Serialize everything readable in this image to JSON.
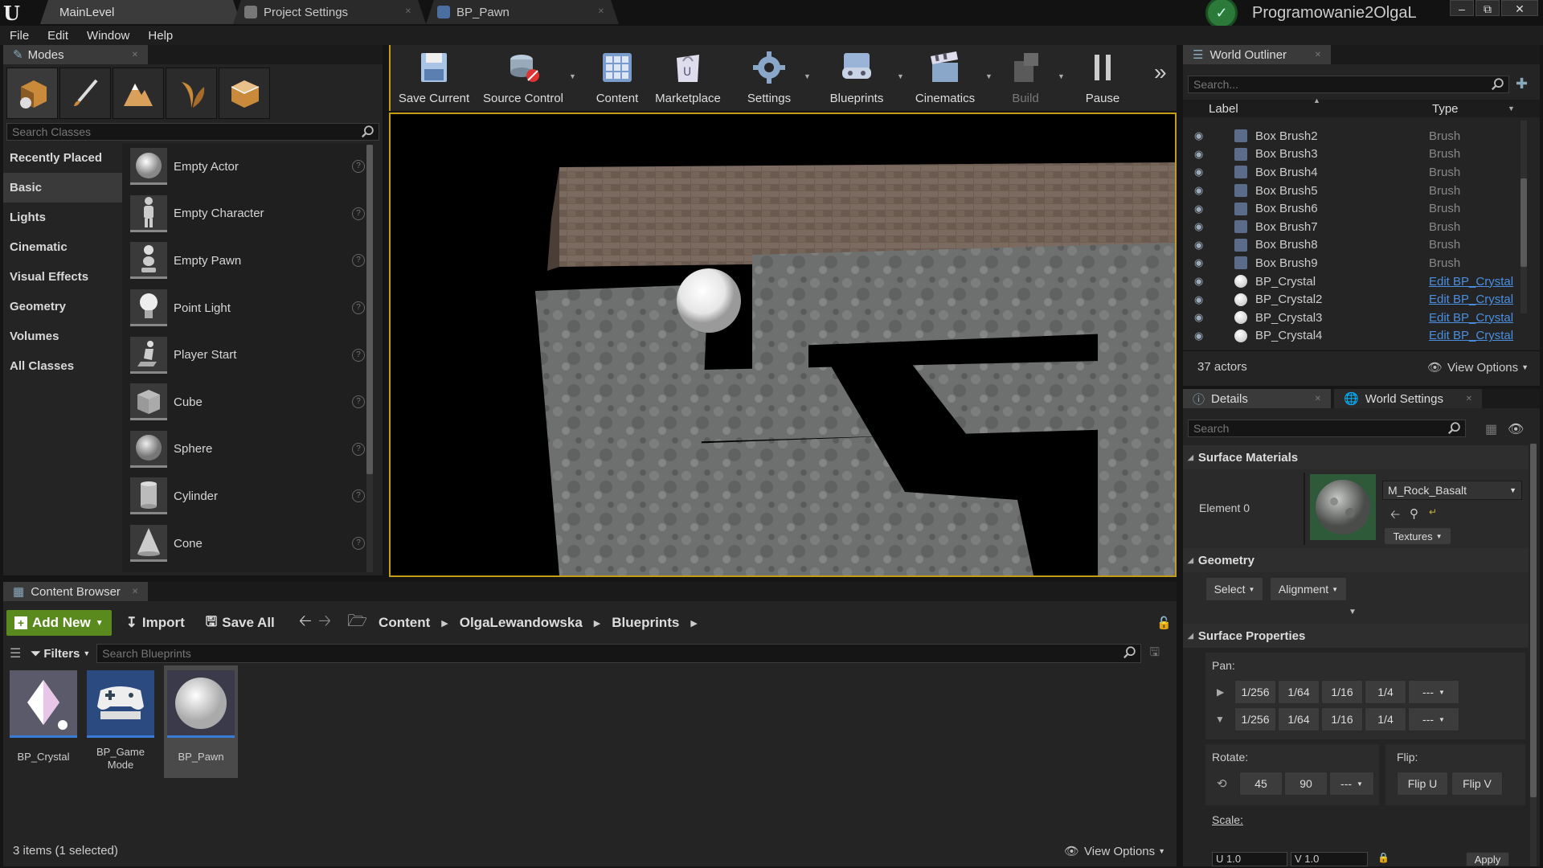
{
  "window": {
    "tabs": [
      {
        "label": "MainLevel"
      },
      {
        "label": "Project Settings"
      },
      {
        "label": "BP_Pawn"
      }
    ],
    "user": "Programowanie2OlgaL",
    "controls": {
      "minimize": "–",
      "restore": "⧉",
      "close": "✕"
    }
  },
  "menu": [
    "File",
    "Edit",
    "Window",
    "Help"
  ],
  "modes": {
    "tab_label": "Modes",
    "search_placeholder": "Search Classes",
    "categories": [
      "Recently Placed",
      "Basic",
      "Lights",
      "Cinematic",
      "Visual Effects",
      "Geometry",
      "Volumes",
      "All Classes"
    ],
    "selected_category": "Basic",
    "items": [
      {
        "label": "Empty Actor",
        "icon": "sphere-icon"
      },
      {
        "label": "Empty Character",
        "icon": "character-icon"
      },
      {
        "label": "Empty Pawn",
        "icon": "pawn-icon"
      },
      {
        "label": "Point Light",
        "icon": "bulb-icon"
      },
      {
        "label": "Player Start",
        "icon": "player-start-icon"
      },
      {
        "label": "Cube",
        "icon": "cube-icon"
      },
      {
        "label": "Sphere",
        "icon": "sphere-icon"
      },
      {
        "label": "Cylinder",
        "icon": "cylinder-icon"
      },
      {
        "label": "Cone",
        "icon": "cone-icon"
      }
    ],
    "help_glyph": "?"
  },
  "toolbar": {
    "items": [
      {
        "label": "Save Current"
      },
      {
        "label": "Source Control"
      },
      {
        "label": "Content"
      },
      {
        "label": "Marketplace"
      },
      {
        "label": "Settings"
      },
      {
        "label": "Blueprints"
      },
      {
        "label": "Cinematics"
      },
      {
        "label": "Build"
      },
      {
        "label": "Pause"
      }
    ],
    "overflow": "»"
  },
  "content_browser": {
    "tab_label": "Content Browser",
    "add_new": "Add New",
    "import": "Import",
    "save_all": "Save All",
    "breadcrumb": [
      "Content",
      "OlgaLewandowska",
      "Blueprints"
    ],
    "filters": "Filters",
    "search_placeholder": "Search Blueprints",
    "assets": [
      {
        "label": "BP_Crystal"
      },
      {
        "label": "BP_Game Mode"
      },
      {
        "label": "BP_Pawn"
      }
    ],
    "status": "3 items (1 selected)",
    "view_options": "View Options"
  },
  "outliner": {
    "tab_label": "World Outliner",
    "search_placeholder": "Search...",
    "col_label": "Label",
    "col_type": "Type",
    "rows": [
      {
        "label": "Box Brush2",
        "type": "Brush",
        "link": false
      },
      {
        "label": "Box Brush3",
        "type": "Brush",
        "link": false
      },
      {
        "label": "Box Brush4",
        "type": "Brush",
        "link": false
      },
      {
        "label": "Box Brush5",
        "type": "Brush",
        "link": false
      },
      {
        "label": "Box Brush6",
        "type": "Brush",
        "link": false
      },
      {
        "label": "Box Brush7",
        "type": "Brush",
        "link": false
      },
      {
        "label": "Box Brush8",
        "type": "Brush",
        "link": false
      },
      {
        "label": "Box Brush9",
        "type": "Brush",
        "link": false
      },
      {
        "label": "BP_Crystal",
        "type": "Edit BP_Crystal",
        "link": true
      },
      {
        "label": "BP_Crystal2",
        "type": "Edit BP_Crystal",
        "link": true
      },
      {
        "label": "BP_Crystal3",
        "type": "Edit BP_Crystal",
        "link": true
      },
      {
        "label": "BP_Crystal4",
        "type": "Edit BP_Crystal",
        "link": true
      }
    ],
    "actor_count": "37 actors",
    "view_options": "View Options"
  },
  "details": {
    "tab_label": "Details",
    "world_settings_label": "World Settings",
    "search_placeholder": "Search",
    "surface_materials": {
      "header": "Surface Materials",
      "element": "Element 0",
      "material": "M_Rock_Basalt",
      "textures": "Textures"
    },
    "geometry": {
      "header": "Geometry",
      "select": "Select",
      "alignment": "Alignment"
    },
    "surface_properties": {
      "header": "Surface Properties",
      "pan_label": "Pan:",
      "pan_values": [
        "1/256",
        "1/64",
        "1/16",
        "1/4",
        "---"
      ],
      "rotate_label": "Rotate:",
      "rotate_values": [
        "45",
        "90",
        "---"
      ],
      "flip_label": "Flip:",
      "flip_u": "Flip U",
      "flip_v": "Flip V",
      "scale_label": "Scale:",
      "scale_u": "U 1.0",
      "scale_v": "V 1.0",
      "apply": "Apply"
    }
  },
  "colors": {
    "accent": "#c59b1a",
    "green": "#5a8a1e",
    "link": "#4a8fe0"
  }
}
